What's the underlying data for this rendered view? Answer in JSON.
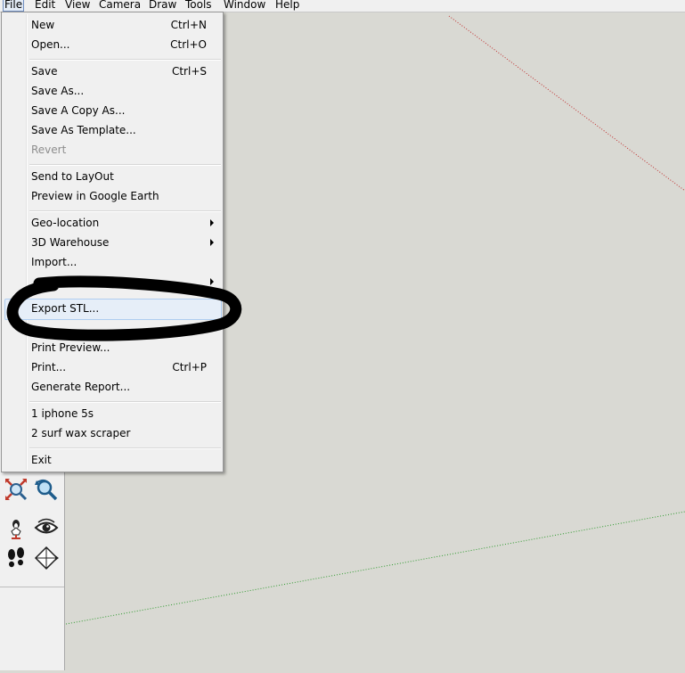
{
  "menubar": {
    "items": [
      "File",
      "Edit",
      "View",
      "Camera",
      "Draw",
      "Tools",
      "Window",
      "Help"
    ]
  },
  "file_menu": {
    "new": {
      "label": "New",
      "shortcut": "Ctrl+N"
    },
    "open": {
      "label": "Open...",
      "shortcut": "Ctrl+O"
    },
    "save": {
      "label": "Save",
      "shortcut": "Ctrl+S"
    },
    "save_as": {
      "label": "Save As..."
    },
    "save_copy_as": {
      "label": "Save A Copy As..."
    },
    "save_as_template": {
      "label": "Save As Template..."
    },
    "revert": {
      "label": "Revert"
    },
    "send_to_layout": {
      "label": "Send to LayOut"
    },
    "preview_google_earth": {
      "label": "Preview in Google Earth"
    },
    "geo_location": {
      "label": "Geo-location"
    },
    "warehouse": {
      "label": "3D Warehouse"
    },
    "import": {
      "label": "Import..."
    },
    "export_stl": {
      "label": "Export STL..."
    },
    "print_preview": {
      "label": "Print Preview..."
    },
    "print": {
      "label": "Print...",
      "shortcut": "Ctrl+P"
    },
    "generate_report": {
      "label": "Generate Report..."
    },
    "recent_1": {
      "label": "1 iphone 5s"
    },
    "recent_2": {
      "label": "2 surf wax scraper"
    },
    "exit": {
      "label": "Exit"
    }
  },
  "toolbar": {
    "icons": [
      "zoom-extents-icon",
      "previous-view-icon",
      "position-camera-icon",
      "look-around-icon",
      "walk-icon",
      "section-plane-icon"
    ]
  },
  "colors": {
    "viewport_bg": "#d9d9d3",
    "menu_bg": "#f0f0f0",
    "red_axis": "#c03030",
    "green_axis": "#2f9a2f",
    "annotation": "#000000"
  }
}
